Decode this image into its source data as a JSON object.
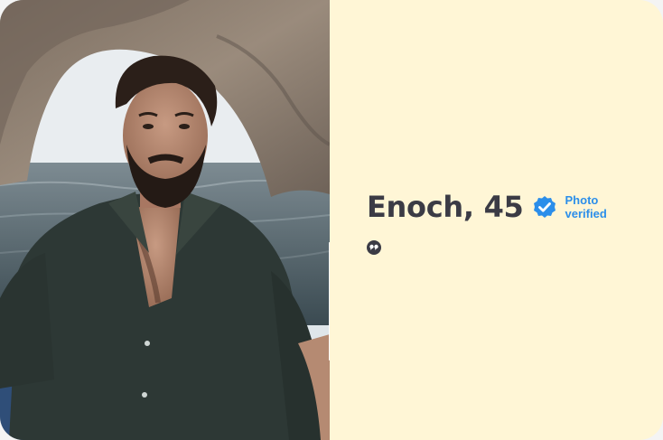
{
  "profile": {
    "name_age": "Enoch, 45",
    "verified_line1": "Photo",
    "verified_line2": "verified"
  },
  "icons": {
    "expand": "expand-icon",
    "verified_badge": "verified-check-icon",
    "quote": "quote-icon"
  },
  "colors": {
    "card_background": "#fff6d6",
    "name_text": "#3b3b45",
    "verified_accent": "#2b8eea"
  }
}
